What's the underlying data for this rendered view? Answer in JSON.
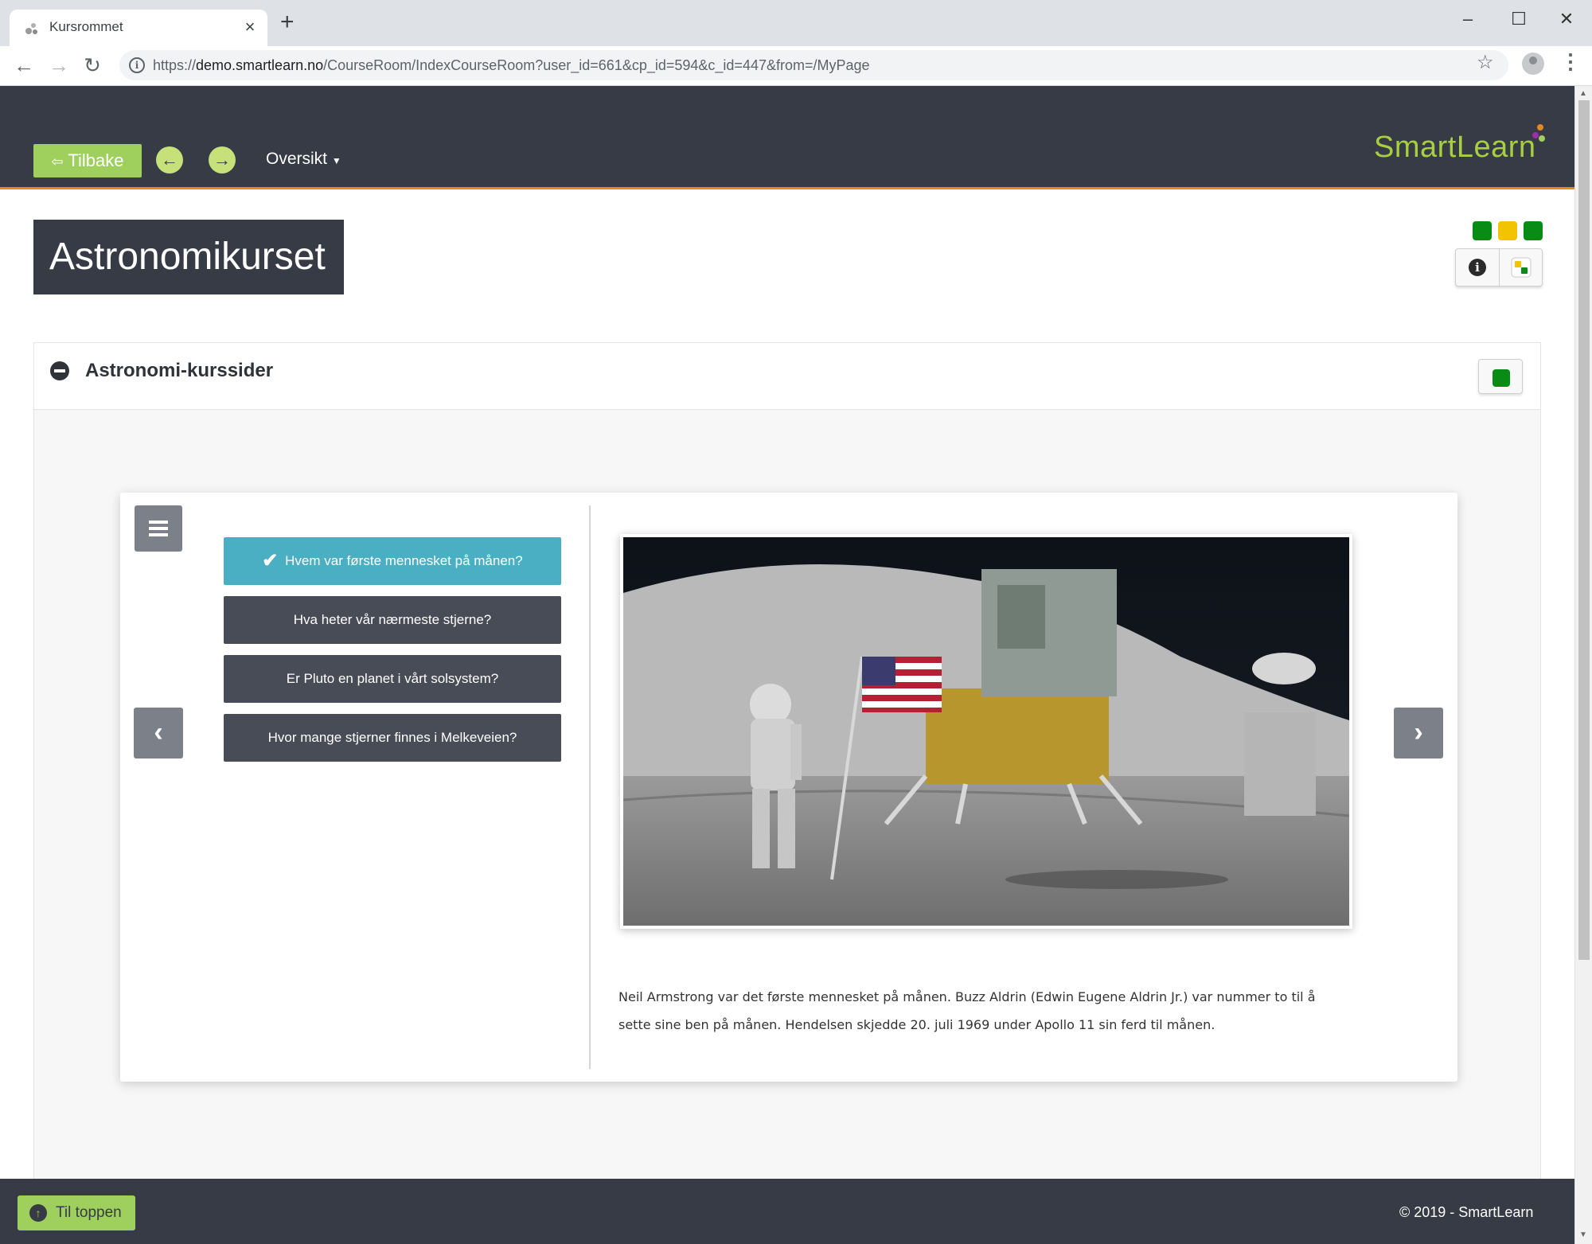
{
  "browser": {
    "tab_title": "Kursrommet",
    "tab_close": "×",
    "new_tab": "+",
    "url_prefix": "https://",
    "url_host": "demo.smartlearn.no",
    "url_path": "/CourseRoom/IndexCourseRoom?user_id=661&cp_id=594&c_id=447&from=/MyPage",
    "window_controls": {
      "minimize": "–",
      "maximize": "☐",
      "close": "✕"
    },
    "nav_icons": {
      "back": "←",
      "forward": "→",
      "reload": "↻",
      "star": "☆",
      "menu": "⋮"
    }
  },
  "header": {
    "back_label": "Tilbake",
    "prev_icon": "←",
    "next_icon": "→",
    "overview_label": "Oversikt",
    "logo_text": "SmartLearn",
    "accent_color": "#e48a1c",
    "brand_green": "#9fd05d"
  },
  "course": {
    "title": "Astronomikurset",
    "status_colors": [
      "#088c16",
      "#f2c300",
      "#088c16"
    ],
    "info_icon": "i"
  },
  "section": {
    "title": "Astronomi-kurssider",
    "status_color": "#088c16"
  },
  "quiz": {
    "questions": [
      {
        "label": "Hvem var første mennesket på månen?",
        "state": "completed"
      },
      {
        "label": "Hva heter vår nærmeste stjerne?",
        "state": "default"
      },
      {
        "label": "Er Pluto en planet i vårt solsystem?",
        "state": "default"
      },
      {
        "label": "Hvor mange stjerner finnes i Melkeveien?",
        "state": "default"
      }
    ],
    "check_icon": "✔",
    "prev_arrow": "‹",
    "next_arrow": "›",
    "caption_line1": "Neil Armstrong var det første mennesket på månen. Buzz Aldrin (Edwin Eugene Aldrin Jr.) var nummer to til å",
    "caption_line2": "sette sine ben på månen. Hendelsen skjedde 20. juli 1969 under Apollo 11 sin ferd til månen."
  },
  "footer": {
    "to_top_label": "Til toppen",
    "copyright": "© 2019 - SmartLearn"
  }
}
